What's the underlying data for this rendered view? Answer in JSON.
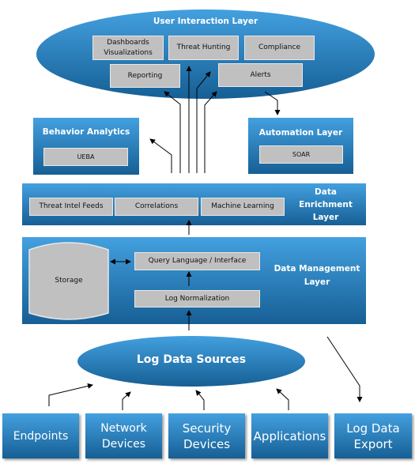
{
  "user_layer": {
    "title": "User Interaction Layer",
    "items": [
      "Dashboards Visualizations",
      "Threat Hunting",
      "Compliance",
      "Reporting",
      "Alerts"
    ]
  },
  "behavior": {
    "title": "Behavior Analytics",
    "item": "UEBA"
  },
  "automation": {
    "title": "Automation Layer",
    "item": "SOAR"
  },
  "enrichment": {
    "title": "Data Enrichment Layer",
    "items": [
      "Threat Intel Feeds",
      "Correlations",
      "Machine Learning"
    ]
  },
  "management": {
    "title": "Data Management Layer",
    "storage": "Storage",
    "query": "Query Language / Interface",
    "normalization": "Log Normalization"
  },
  "sources": {
    "title": "Log Data Sources",
    "items": [
      "Endpoints",
      "Network Devices",
      "Security Devices",
      "Applications",
      "Log Data Export"
    ]
  },
  "colors": {
    "blue_top": "#43a0df",
    "blue_bottom": "#165f95",
    "box_grey": "#c0c0c0"
  }
}
